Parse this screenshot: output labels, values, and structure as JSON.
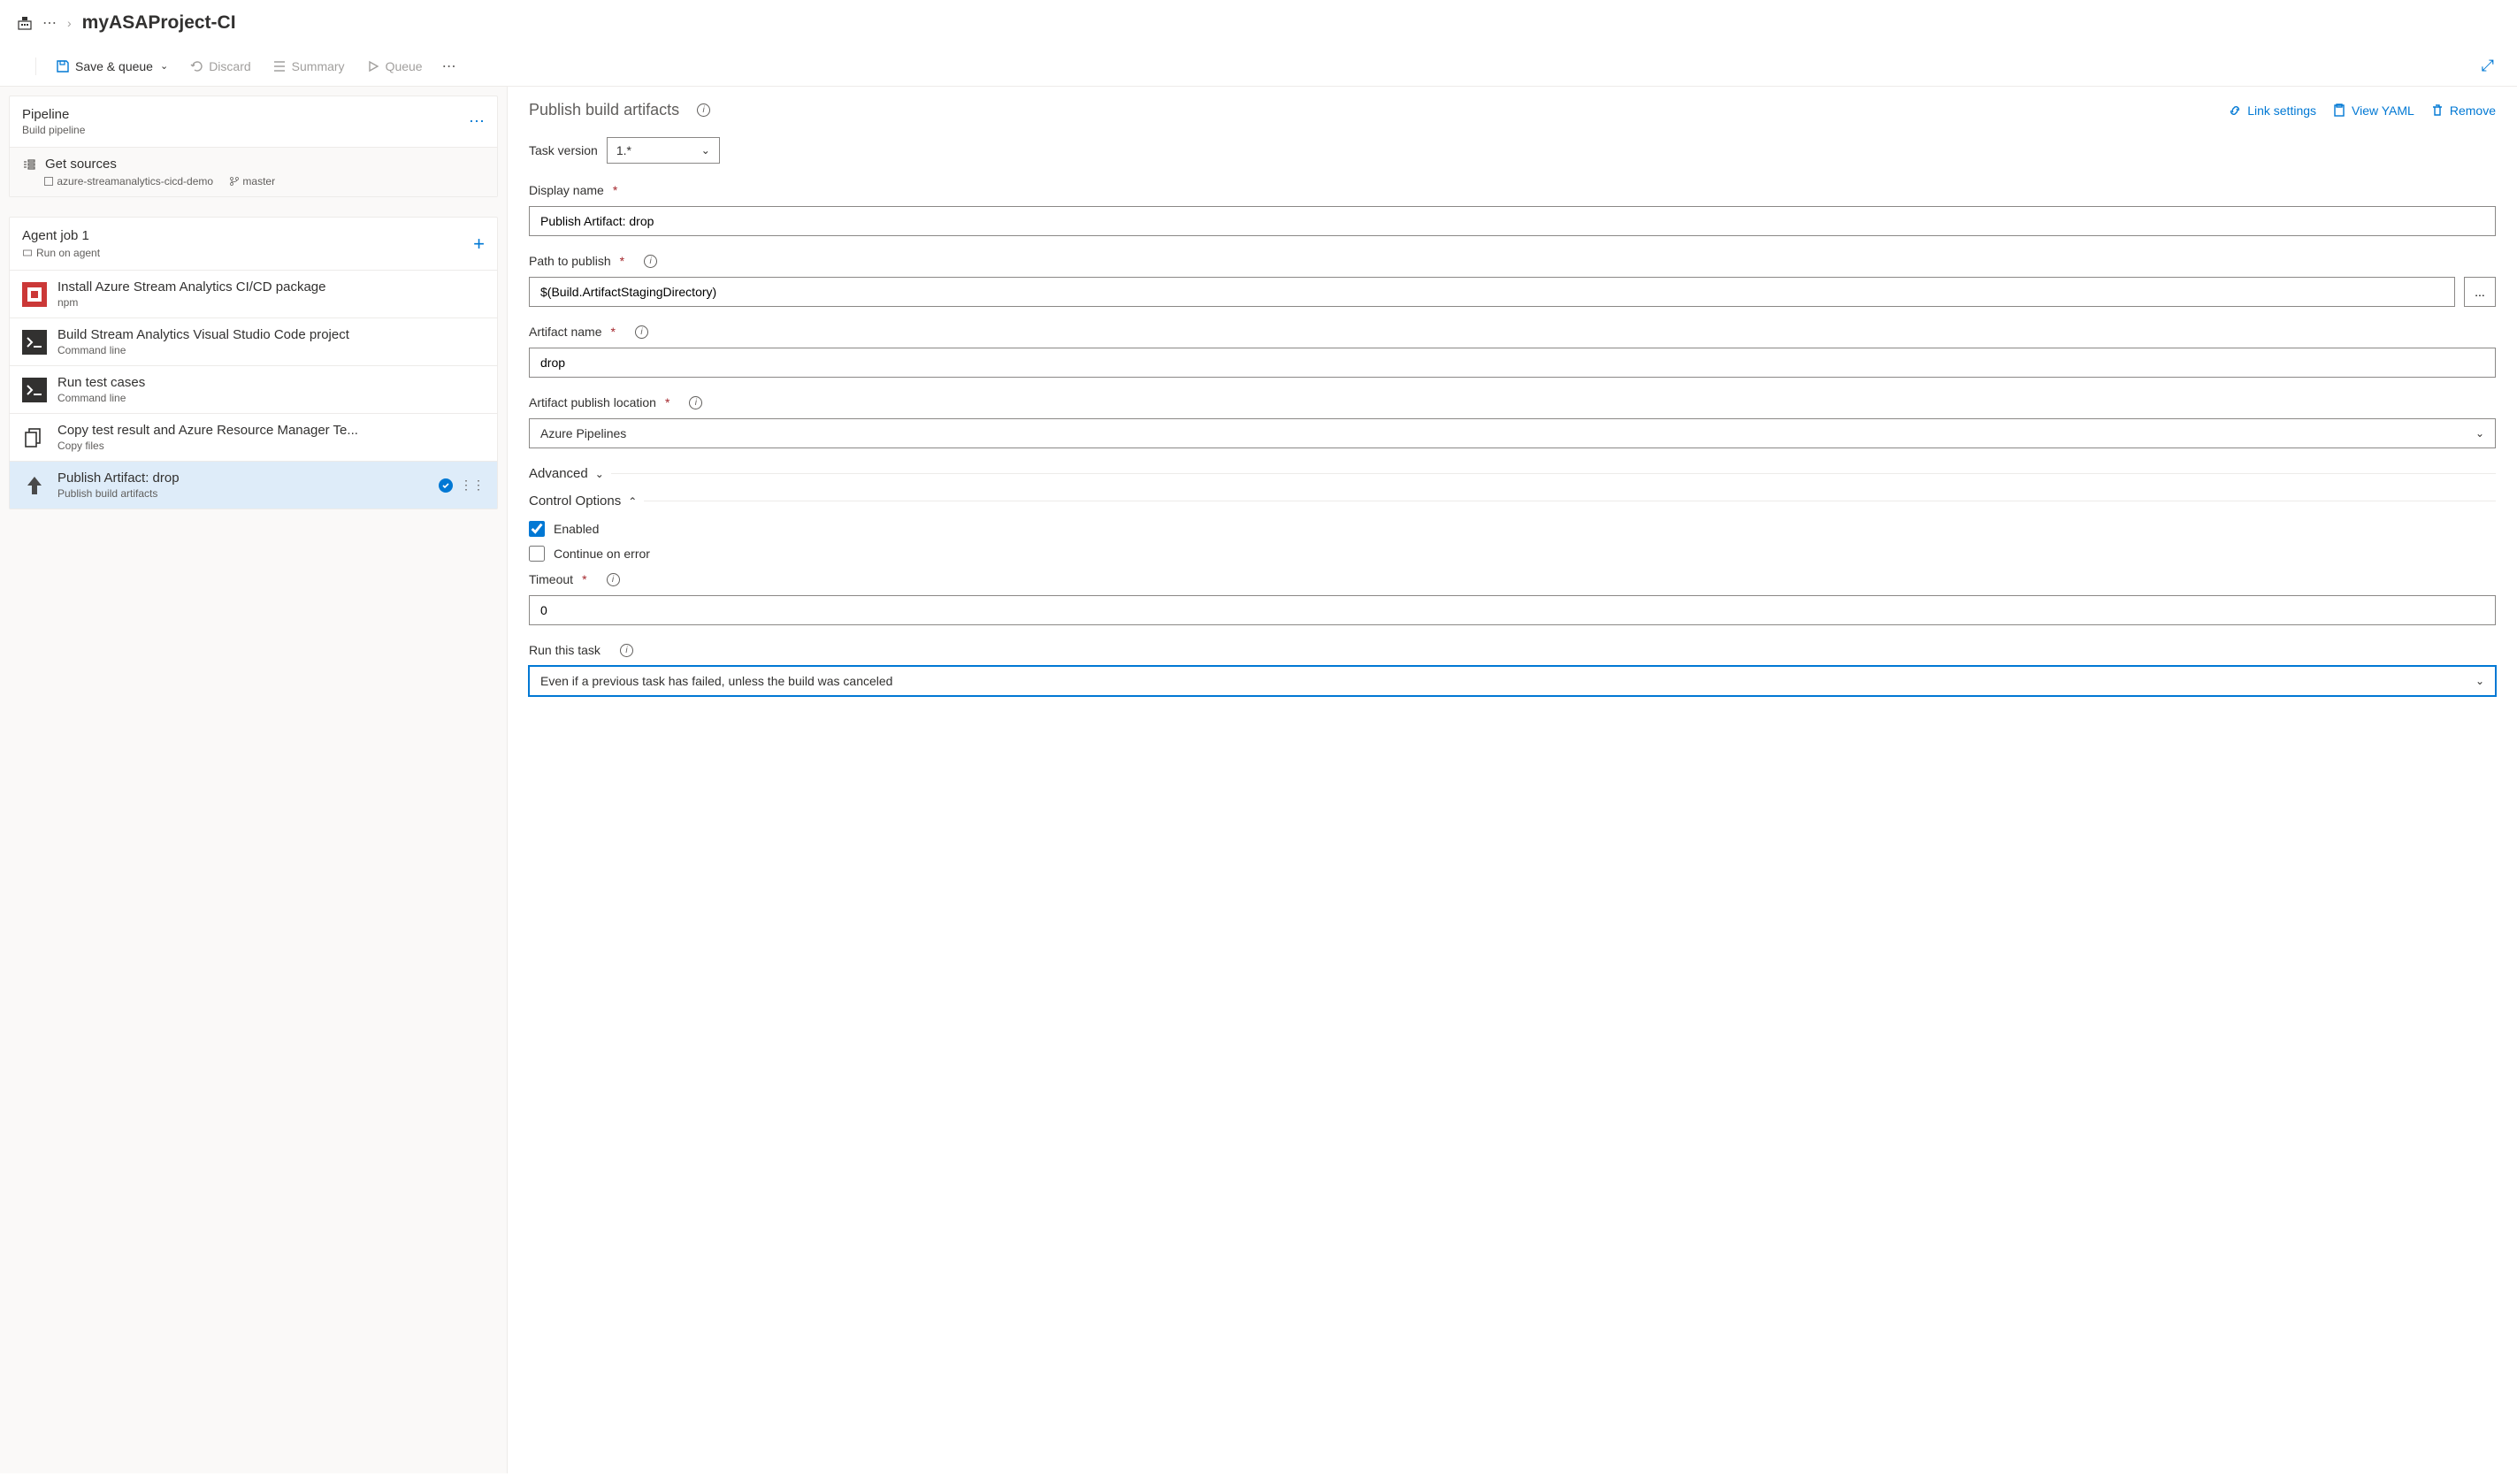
{
  "breadcrumb": {
    "title": "myASAProject-CI"
  },
  "toolbar": {
    "save_queue": "Save & queue",
    "discard": "Discard",
    "summary": "Summary",
    "queue": "Queue"
  },
  "pipeline": {
    "title": "Pipeline",
    "subtitle": "Build pipeline"
  },
  "sources": {
    "title": "Get sources",
    "repo": "azure-streamanalytics-cicd-demo",
    "branch": "master"
  },
  "agent": {
    "title": "Agent job 1",
    "subtitle": "Run on agent"
  },
  "tasks": [
    {
      "title": "Install Azure Stream Analytics CI/CD package",
      "sub": "npm",
      "icon": "npm"
    },
    {
      "title": "Build Stream Analytics Visual Studio Code project",
      "sub": "Command line",
      "icon": "cmd"
    },
    {
      "title": "Run test cases",
      "sub": "Command line",
      "icon": "cmd"
    },
    {
      "title": "Copy test result and Azure Resource Manager Te...",
      "sub": "Copy files",
      "icon": "copy"
    },
    {
      "title": "Publish Artifact: drop",
      "sub": "Publish build artifacts",
      "icon": "upload"
    }
  ],
  "details": {
    "heading": "Publish build artifacts",
    "links": {
      "link_settings": "Link settings",
      "view_yaml": "View YAML",
      "remove": "Remove"
    },
    "task_version_label": "Task version",
    "task_version": "1.*",
    "display_name_label": "Display name",
    "display_name": "Publish Artifact: drop",
    "path_label": "Path to publish",
    "path": "$(Build.ArtifactStagingDirectory)",
    "artifact_name_label": "Artifact name",
    "artifact_name": "drop",
    "location_label": "Artifact publish location",
    "location": "Azure Pipelines",
    "advanced": "Advanced",
    "control_options": "Control Options",
    "enabled_label": "Enabled",
    "continue_label": "Continue on error",
    "timeout_label": "Timeout",
    "timeout": "0",
    "run_task_label": "Run this task",
    "run_task": "Even if a previous task has failed, unless the build was canceled"
  }
}
